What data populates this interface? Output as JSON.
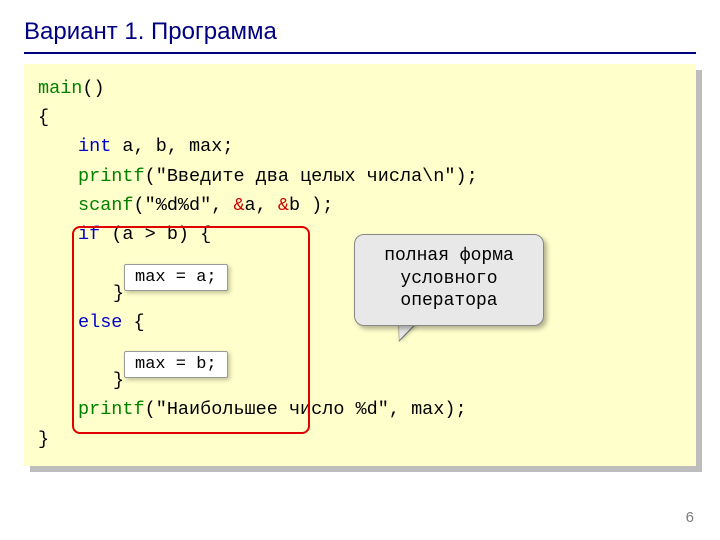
{
  "title": "Вариант 1. Программа",
  "code": {
    "l1a": "main",
    "l1b": "()",
    "l2": "{",
    "l3a": "int",
    "l3b": " a, b, max;",
    "l4a": "printf",
    "l4b": "(\"Введите два целых числа\\n\");",
    "l5a": "scanf",
    "l5b": "(\"%d%d\", ",
    "l5amp": "&",
    "l5c": "a, ",
    "l5d": "b );",
    "l6a": "if",
    "l6b": " (a > b) {",
    "l7": "",
    "l8": "}",
    "l9a": "else",
    "l9b": " {",
    "l10": "",
    "l11": "}",
    "l12a": "printf",
    "l12b": "(\"Наибольшее число %d\", max);",
    "l13": "}"
  },
  "mini_a": "max = a;",
  "mini_b": "max = b;",
  "callout": {
    "line1": "полная форма",
    "line2": "условного",
    "line3": "оператора"
  },
  "page_number": "6"
}
